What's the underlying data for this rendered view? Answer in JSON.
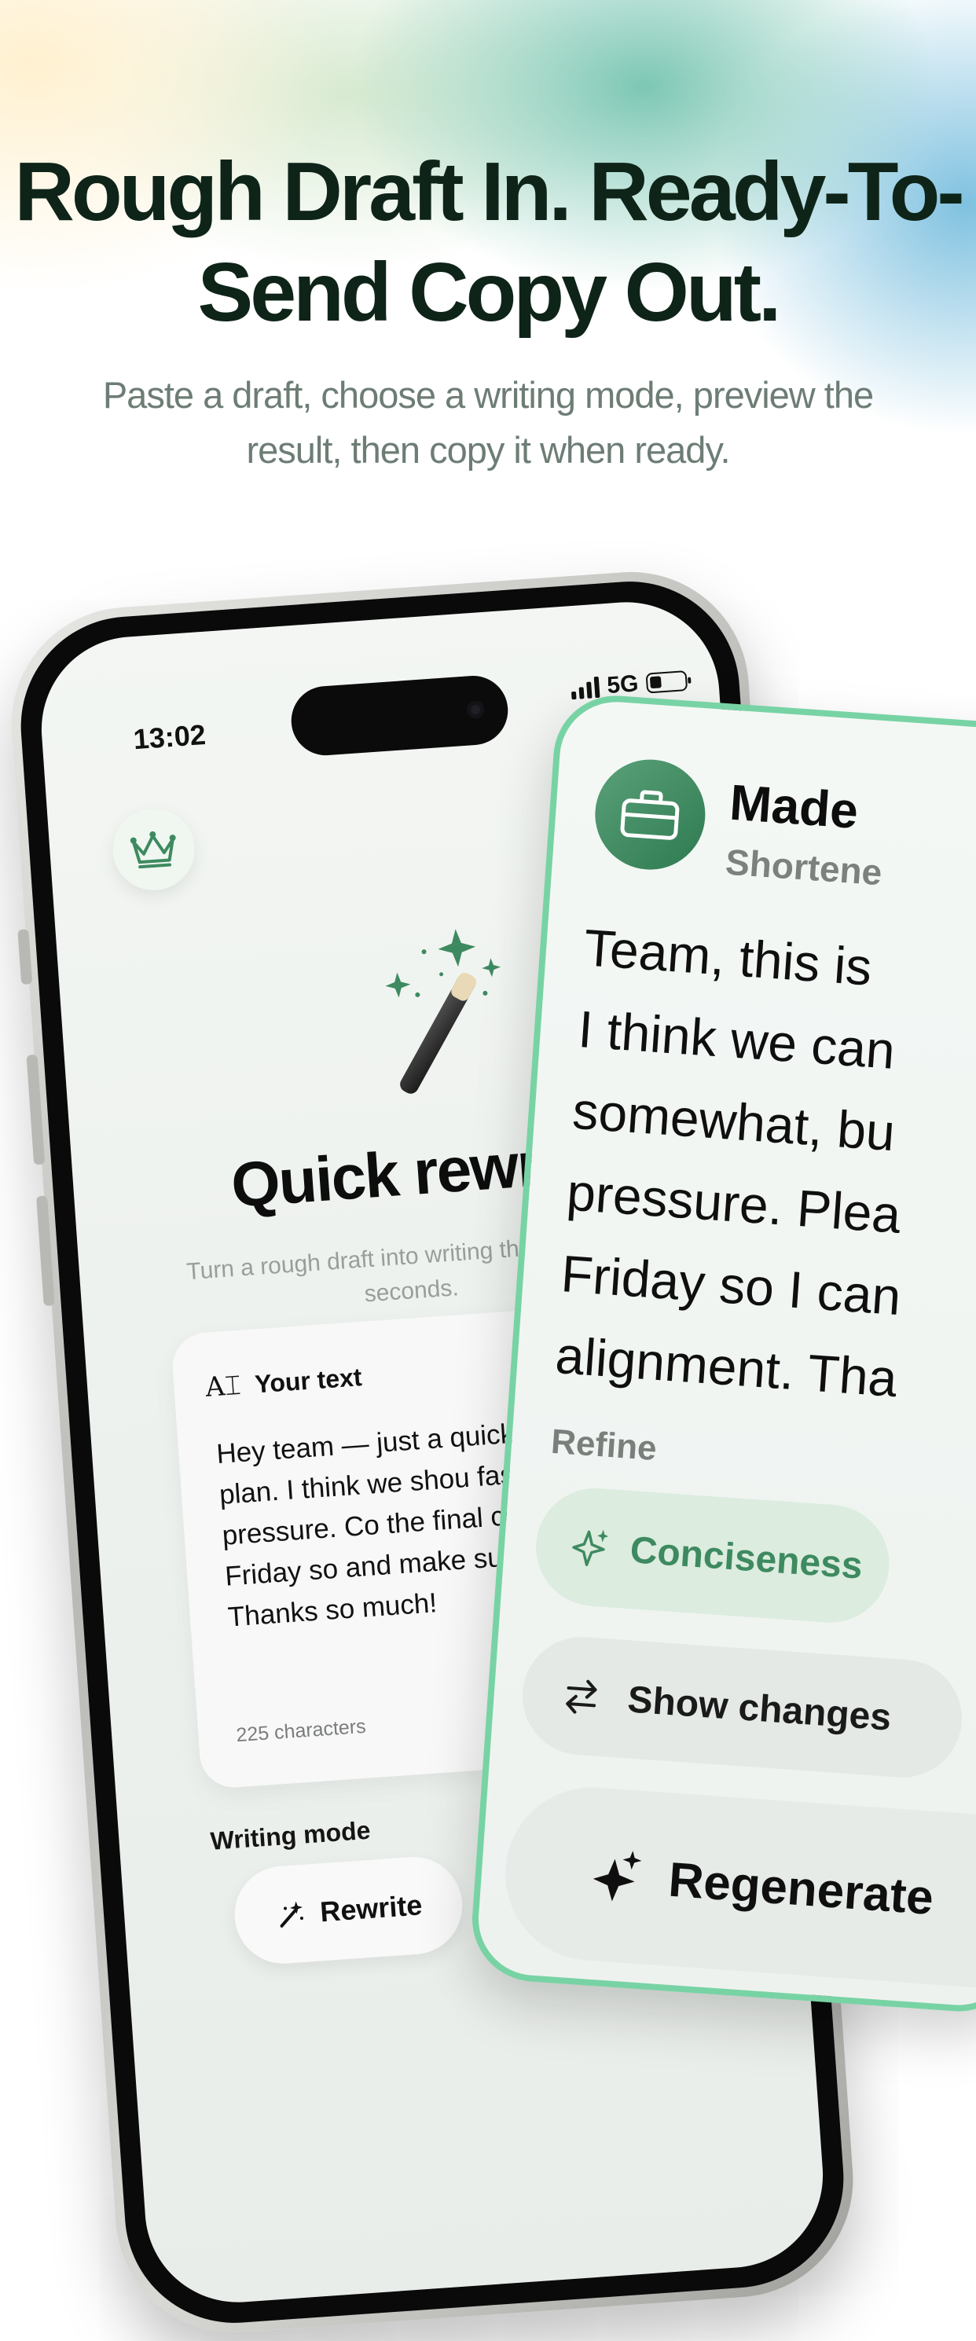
{
  "hero": {
    "headline": "Rough Draft In. Ready-To-Send Copy Out.",
    "subheadline": "Paste a draft, choose a writing mode, preview the result, then copy it when ready."
  },
  "status_bar": {
    "time": "13:02",
    "network": "5G"
  },
  "editor": {
    "title": "Quick rewrit",
    "description": "Turn a rough draft into writing tha you — in seconds.",
    "input_label": "Your text",
    "input_value": "Hey team — just a quick foll launch plan. I think we shou faster, but no pressure. Co the final copy by Friday so and make sure everything Thanks so much!",
    "char_count": "225 characters",
    "mode_label": "Writing mode",
    "modes": [
      {
        "label": "Rewrite"
      }
    ]
  },
  "result": {
    "title": "Made",
    "subtitle": "Shortene",
    "text": "Team, this is \nI think we can\nsomewhat, bu\npressure. Plea\nFriday so I can\nalignment. Tha",
    "refine_label": "Refine",
    "refine_option": "Conciseness",
    "show_changes": "Show changes",
    "regenerate": "Regenerate"
  },
  "colors": {
    "brand_green": "#3e8a60",
    "card_border": "#78d3a4",
    "headline": "#0f2419"
  },
  "icons": [
    "crown-icon",
    "keyboard-icon",
    "magic-wand-icon",
    "text-cursor-icon",
    "wand-icon",
    "badge-check-icon",
    "briefcase-icon",
    "sparkle-icon",
    "swap-arrows-icon",
    "sparkles-icon"
  ]
}
